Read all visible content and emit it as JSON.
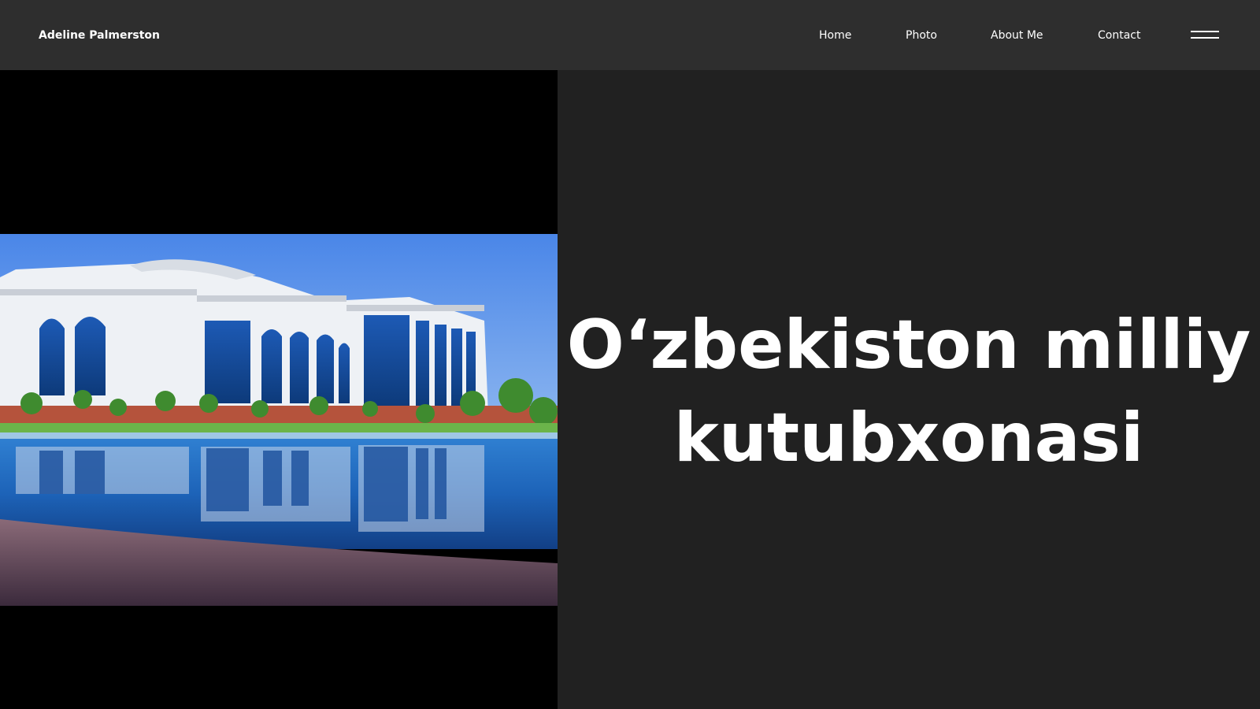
{
  "header": {
    "brand": "Adeline Palmerston",
    "nav": [
      {
        "label": "Home"
      },
      {
        "label": "Photo"
      },
      {
        "label": "About Me"
      },
      {
        "label": "Contact"
      }
    ],
    "menu_icon": "hamburger-icon"
  },
  "hero": {
    "title_line1": "O‘zbekiston milliy",
    "title_line2": "kutubxonasi",
    "image_subject": "national-library-building"
  },
  "colors": {
    "header_bg": "#2e2e2e",
    "page_bg": "#212121",
    "image_panel_bg": "#000000",
    "text": "#ffffff"
  }
}
